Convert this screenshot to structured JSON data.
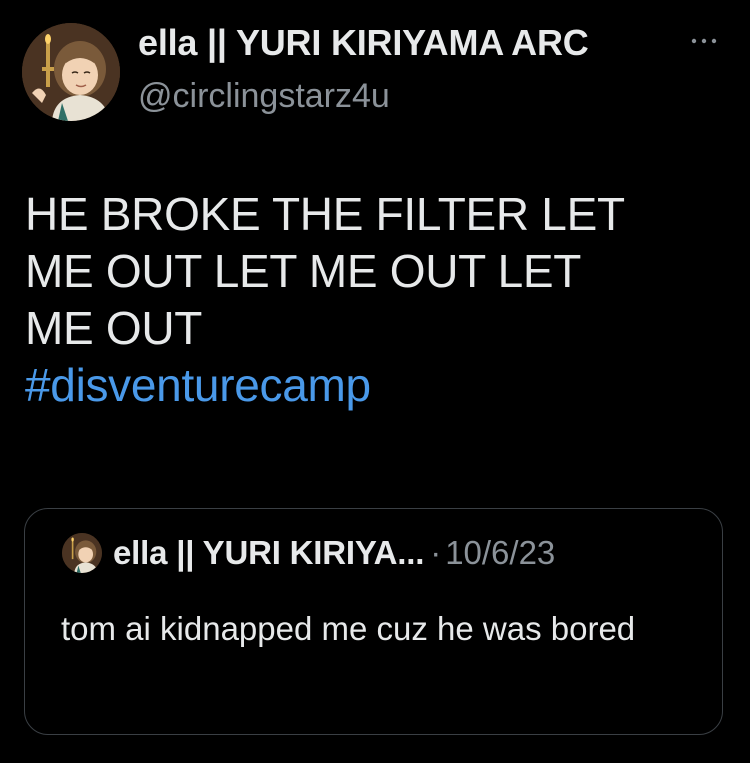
{
  "tweet": {
    "author": {
      "display_name": "ella || YURI KIRIYAMA ARC",
      "handle": "@circlingstarz4u",
      "avatar_icon": "avatar-illustration"
    },
    "more_icon": "more-horizontal-icon",
    "text_lines": [
      "HE BROKE THE FILTER LET",
      "ME OUT LET ME OUT LET",
      "ME OUT"
    ],
    "hashtag": "#disventurecamp",
    "quote": {
      "display_name": "ella || YURI KIRIYA...",
      "separator": "·",
      "date": "10/6/23",
      "text": "tom ai kidnapped me cuz he was bored"
    }
  },
  "colors": {
    "background": "#000000",
    "text": "#e7e9ea",
    "secondary_text": "#8b9299",
    "link": "#4a99e9",
    "border": "#3a3f44"
  }
}
